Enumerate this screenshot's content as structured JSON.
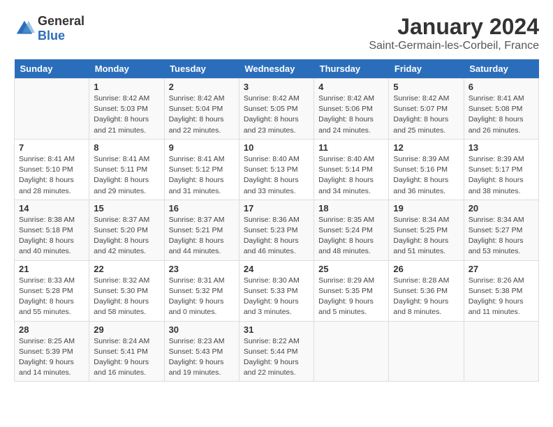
{
  "header": {
    "logo_general": "General",
    "logo_blue": "Blue",
    "title": "January 2024",
    "subtitle": "Saint-Germain-les-Corbeil, France"
  },
  "weekdays": [
    "Sunday",
    "Monday",
    "Tuesday",
    "Wednesday",
    "Thursday",
    "Friday",
    "Saturday"
  ],
  "weeks": [
    [
      {
        "day": "",
        "info": ""
      },
      {
        "day": "1",
        "info": "Sunrise: 8:42 AM\nSunset: 5:03 PM\nDaylight: 8 hours\nand 21 minutes."
      },
      {
        "day": "2",
        "info": "Sunrise: 8:42 AM\nSunset: 5:04 PM\nDaylight: 8 hours\nand 22 minutes."
      },
      {
        "day": "3",
        "info": "Sunrise: 8:42 AM\nSunset: 5:05 PM\nDaylight: 8 hours\nand 23 minutes."
      },
      {
        "day": "4",
        "info": "Sunrise: 8:42 AM\nSunset: 5:06 PM\nDaylight: 8 hours\nand 24 minutes."
      },
      {
        "day": "5",
        "info": "Sunrise: 8:42 AM\nSunset: 5:07 PM\nDaylight: 8 hours\nand 25 minutes."
      },
      {
        "day": "6",
        "info": "Sunrise: 8:41 AM\nSunset: 5:08 PM\nDaylight: 8 hours\nand 26 minutes."
      }
    ],
    [
      {
        "day": "7",
        "info": "Sunrise: 8:41 AM\nSunset: 5:10 PM\nDaylight: 8 hours\nand 28 minutes."
      },
      {
        "day": "8",
        "info": "Sunrise: 8:41 AM\nSunset: 5:11 PM\nDaylight: 8 hours\nand 29 minutes."
      },
      {
        "day": "9",
        "info": "Sunrise: 8:41 AM\nSunset: 5:12 PM\nDaylight: 8 hours\nand 31 minutes."
      },
      {
        "day": "10",
        "info": "Sunrise: 8:40 AM\nSunset: 5:13 PM\nDaylight: 8 hours\nand 33 minutes."
      },
      {
        "day": "11",
        "info": "Sunrise: 8:40 AM\nSunset: 5:14 PM\nDaylight: 8 hours\nand 34 minutes."
      },
      {
        "day": "12",
        "info": "Sunrise: 8:39 AM\nSunset: 5:16 PM\nDaylight: 8 hours\nand 36 minutes."
      },
      {
        "day": "13",
        "info": "Sunrise: 8:39 AM\nSunset: 5:17 PM\nDaylight: 8 hours\nand 38 minutes."
      }
    ],
    [
      {
        "day": "14",
        "info": "Sunrise: 8:38 AM\nSunset: 5:18 PM\nDaylight: 8 hours\nand 40 minutes."
      },
      {
        "day": "15",
        "info": "Sunrise: 8:37 AM\nSunset: 5:20 PM\nDaylight: 8 hours\nand 42 minutes."
      },
      {
        "day": "16",
        "info": "Sunrise: 8:37 AM\nSunset: 5:21 PM\nDaylight: 8 hours\nand 44 minutes."
      },
      {
        "day": "17",
        "info": "Sunrise: 8:36 AM\nSunset: 5:23 PM\nDaylight: 8 hours\nand 46 minutes."
      },
      {
        "day": "18",
        "info": "Sunrise: 8:35 AM\nSunset: 5:24 PM\nDaylight: 8 hours\nand 48 minutes."
      },
      {
        "day": "19",
        "info": "Sunrise: 8:34 AM\nSunset: 5:25 PM\nDaylight: 8 hours\nand 51 minutes."
      },
      {
        "day": "20",
        "info": "Sunrise: 8:34 AM\nSunset: 5:27 PM\nDaylight: 8 hours\nand 53 minutes."
      }
    ],
    [
      {
        "day": "21",
        "info": "Sunrise: 8:33 AM\nSunset: 5:28 PM\nDaylight: 8 hours\nand 55 minutes."
      },
      {
        "day": "22",
        "info": "Sunrise: 8:32 AM\nSunset: 5:30 PM\nDaylight: 8 hours\nand 58 minutes."
      },
      {
        "day": "23",
        "info": "Sunrise: 8:31 AM\nSunset: 5:32 PM\nDaylight: 9 hours\nand 0 minutes."
      },
      {
        "day": "24",
        "info": "Sunrise: 8:30 AM\nSunset: 5:33 PM\nDaylight: 9 hours\nand 3 minutes."
      },
      {
        "day": "25",
        "info": "Sunrise: 8:29 AM\nSunset: 5:35 PM\nDaylight: 9 hours\nand 5 minutes."
      },
      {
        "day": "26",
        "info": "Sunrise: 8:28 AM\nSunset: 5:36 PM\nDaylight: 9 hours\nand 8 minutes."
      },
      {
        "day": "27",
        "info": "Sunrise: 8:26 AM\nSunset: 5:38 PM\nDaylight: 9 hours\nand 11 minutes."
      }
    ],
    [
      {
        "day": "28",
        "info": "Sunrise: 8:25 AM\nSunset: 5:39 PM\nDaylight: 9 hours\nand 14 minutes."
      },
      {
        "day": "29",
        "info": "Sunrise: 8:24 AM\nSunset: 5:41 PM\nDaylight: 9 hours\nand 16 minutes."
      },
      {
        "day": "30",
        "info": "Sunrise: 8:23 AM\nSunset: 5:43 PM\nDaylight: 9 hours\nand 19 minutes."
      },
      {
        "day": "31",
        "info": "Sunrise: 8:22 AM\nSunset: 5:44 PM\nDaylight: 9 hours\nand 22 minutes."
      },
      {
        "day": "",
        "info": ""
      },
      {
        "day": "",
        "info": ""
      },
      {
        "day": "",
        "info": ""
      }
    ]
  ]
}
